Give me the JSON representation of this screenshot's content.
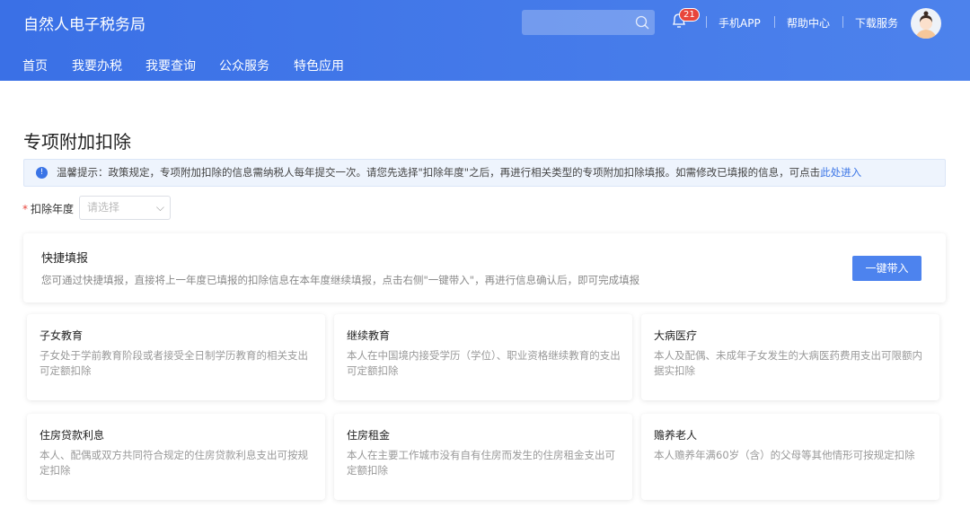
{
  "header": {
    "title": "自然人电子税务局",
    "notification_count": "21",
    "links": [
      "手机APP",
      "帮助中心",
      "下载服务"
    ]
  },
  "nav": [
    "首页",
    "我要办税",
    "我要查询",
    "公众服务",
    "特色应用"
  ],
  "page_title": "专项附加扣除",
  "alert": {
    "text": "温馨提示：政策规定，专项附加扣除的信息需纳税人每年提交一次。请您先选择\"扣除年度\"之后，再进行相关类型的专项附加扣除填报。如需修改已填报的信息，可点击",
    "link": "此处进入"
  },
  "form": {
    "label": "扣除年度",
    "placeholder": "请选择"
  },
  "quick": {
    "title": "快捷填报",
    "desc": "您可通过快捷填报，直接将上一年度已填报的扣除信息在本年度继续填报，点击右侧\"一键带入\"，再进行信息确认后，即可完成填报",
    "button": "一键带入"
  },
  "items": [
    {
      "title": "子女教育",
      "desc": "子女处于学前教育阶段或者接受全日制学历教育的相关支出可定额扣除"
    },
    {
      "title": "继续教育",
      "desc": "本人在中国境内接受学历（学位）、职业资格继续教育的支出可定额扣除"
    },
    {
      "title": "大病医疗",
      "desc": "本人及配偶、未成年子女发生的大病医药费用支出可限额内据实扣除"
    },
    {
      "title": "住房贷款利息",
      "desc": "本人、配偶或双方共同符合规定的住房贷款利息支出可按规定扣除"
    },
    {
      "title": "住房租金",
      "desc": "本人在主要工作城市没有自有住房而发生的住房租金支出可定额扣除"
    },
    {
      "title": "赡养老人",
      "desc": "本人赡养年满60岁（含）的父母等其他情形可按规定扣除"
    }
  ]
}
